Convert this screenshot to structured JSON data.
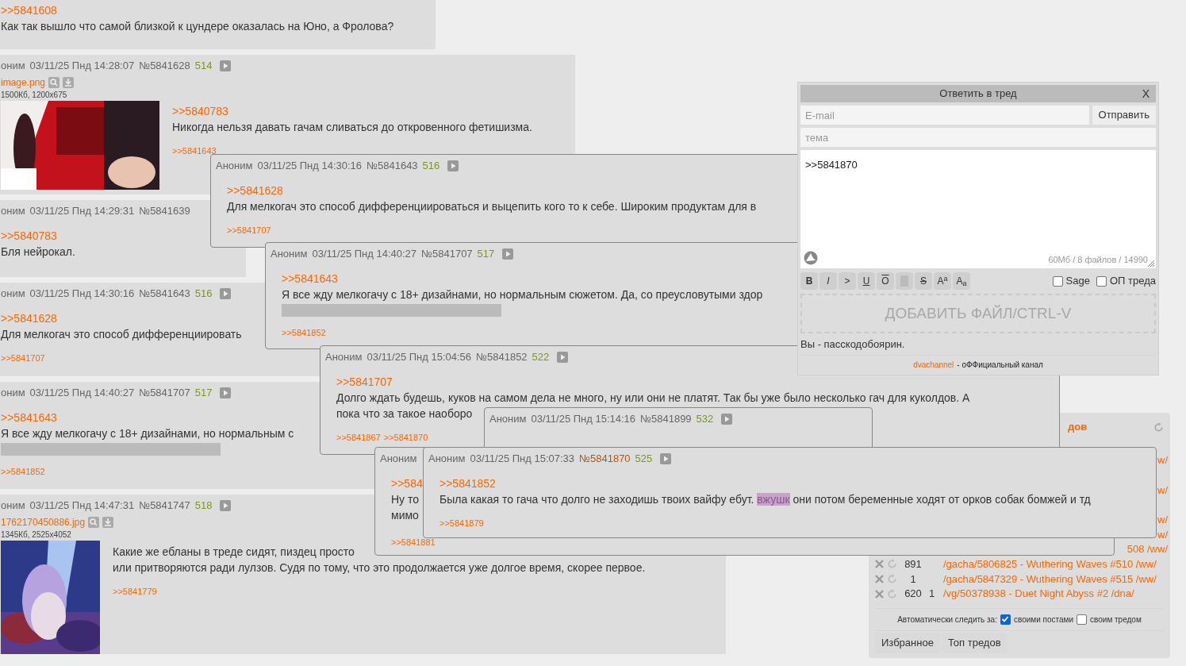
{
  "base_posts": [
    {
      "link": ">>5841608",
      "body": [
        "Как так вышло что самой близкой к цундере оказалась на Юно, а Фролова?"
      ]
    },
    {
      "header": {
        "name": "оним",
        "date": "03/11/25 Пнд 14:28:07",
        "number": "№5841628",
        "count": "514"
      },
      "file": {
        "name": "image.png",
        "info": "1500Кб, 1200x675",
        "kind": "picture"
      },
      "link": ">>5840783",
      "body": [
        "Никогда нельзя давать гачам сливаться до откровенного фетишизма."
      ],
      "replies": [
        ">>5841643"
      ]
    },
    {
      "header": {
        "name": "оним",
        "date": "03/11/25 Пнд 14:29:31",
        "number": "№5841639"
      },
      "link": ">>5840783",
      "body": [
        "Бля нейрокал."
      ]
    },
    {
      "header": {
        "name": "оним",
        "date": "03/11/25 Пнд 14:30:16",
        "number": "№5841643",
        "count": "516"
      },
      "link": ">>5841628",
      "body": [
        "Для мелкогач это способ дифференциировать"
      ],
      "replies": [
        ">>5841707"
      ]
    },
    {
      "header": {
        "name": "оним",
        "date": "03/11/25 Пнд 14:40:27",
        "number": "№5841707",
        "count": "517"
      },
      "link": ">>5841643",
      "body": [
        "Я все жду мелкогачу с 18+ дизайнами, но нормальным с"
      ],
      "spoiler_bar": true,
      "replies": [
        ">>5841852"
      ]
    },
    {
      "header": {
        "name": "оним",
        "date": "03/11/25 Пнд 14:47:31",
        "number": "№5841747",
        "count": "518"
      },
      "file": {
        "name": "1762170450886.jpg",
        "info": "1345Кб, 2525x4052",
        "kind": "picture"
      },
      "body": [
        "Какие же ебланы в треде сидят, пиздец просто",
        "или притворяются ради лулзов. Судя по тому, что это продолжается уже долгое время, скорее первое."
      ],
      "replies": [
        ">>5841779"
      ]
    }
  ],
  "popups": [
    {
      "header": {
        "name": "Аноним",
        "date": "03/11/25 Пнд 14:30:16",
        "number": "№5841643",
        "count": "516"
      },
      "link": ">>5841628",
      "body": [
        [
          {
            "text": "Для мелкогач это способ дифференциироваться и выцепить кого то к себе. Широким продуктам для в",
            "spoiler": false
          }
        ]
      ],
      "replies": [
        ">>5841707"
      ]
    },
    {
      "header": {
        "name": "Аноним",
        "date": "03/11/25 Пнд 14:40:27",
        "number": "№5841707",
        "count": "517"
      },
      "link": ">>5841643",
      "body": [
        [
          {
            "text": "Я все жду мелкогачу с 18+ дизайнами, но нормальным сюжетом. Да, со преусловутыми здор",
            "spoiler": false
          }
        ]
      ],
      "spoiler_bar": true,
      "replies": [
        ">>5841852"
      ]
    },
    {
      "header": {
        "name": "Аноним",
        "date": "03/11/25 Пнд 15:04:56",
        "number": "№5841852",
        "count": "522"
      },
      "link": ">>5841707",
      "body": [
        [
          {
            "text": "Долго ждать будешь, куков на самом дела не много, ну или они не платят. Так бы уже было несколько гач для куколдов. А",
            "spoiler": false
          }
        ],
        [
          {
            "text": "пока что за такое наоборо",
            "spoiler": false
          }
        ]
      ],
      "replies": [
        ">>5841867",
        ">>5841870"
      ]
    },
    {
      "header": {
        "name": "Аноним",
        "date": "03/11/25 Пнд 15:14:16",
        "number": "№5841899",
        "count": "532"
      }
    },
    {
      "header": {
        "name": "Аноним"
      },
      "link": ">>584",
      "body": [
        [
          {
            "text": "Ну то",
            "spoiler": false
          }
        ],
        [
          {
            "text": "мимо",
            "spoiler": false
          }
        ]
      ],
      "replies": [
        ">>5841881"
      ]
    },
    {
      "header": {
        "name": "Аноним",
        "date": "03/11/25 Пнд 15:07:33",
        "number": "№5841870",
        "count": "525",
        "own": true
      },
      "link": ">>5841852",
      "body": [
        [
          {
            "text": "Была какая то гача что долго не заходишь твоих вайфу ебут. ",
            "spoiler": false
          },
          {
            "text": "вжушк",
            "spoiler": true
          },
          {
            "text": " они потом беременные ходят от орков собак бомжей и тд",
            "spoiler": false
          }
        ]
      ],
      "replies": [
        ">>5841879"
      ]
    }
  ],
  "reply_form": {
    "title": "Ответить в тред",
    "close": "X",
    "email": {
      "placeholder": "E-mail"
    },
    "send": "Отправить",
    "subject": {
      "placeholder": "тема"
    },
    "message": ">>5841870",
    "limits": "60Мб / 8 файлов / 14990",
    "toolbar": [
      {
        "kind": "text",
        "label": "B"
      },
      {
        "kind": "text",
        "label": "I"
      },
      {
        "kind": "text",
        "label": ">"
      },
      {
        "kind": "text",
        "label": "U"
      },
      {
        "kind": "text",
        "label": "O"
      },
      {
        "kind": "spoiler"
      },
      {
        "kind": "text",
        "label": "S"
      },
      {
        "kind": "text",
        "label": "A$^{a}$"
      },
      {
        "kind": "text",
        "label": "A$_{a}$"
      }
    ],
    "options": [
      {
        "label": "Sage",
        "checked": false
      },
      {
        "label": "ОП треда",
        "checked": false
      }
    ],
    "dropzone": "ДОБАВИТЬ ФАЙЛ/CTRL-V",
    "status": "Вы - пасскодобоярин.",
    "footer_link": "dvachannel",
    "footer_text": "- оФФициальный канал"
  },
  "favorites": {
    "title": "дов",
    "rows": [
      {
        "kind": "blank"
      },
      {
        "kind": "fragment",
        "text": "w/"
      },
      {
        "kind": "blank"
      },
      {
        "kind": "fragment",
        "text": "w/"
      },
      {
        "kind": "blank"
      },
      {
        "kind": "fragment",
        "text": "w/"
      },
      {
        "kind": "fragment",
        "text": "w/"
      },
      {
        "kind": "fragment",
        "text": "508 /ww/"
      },
      {
        "kind": "thread",
        "count": "891",
        "title": "/gacha/5806825 - Wuthering Waves #510 /ww/"
      },
      {
        "kind": "thread",
        "count": "1",
        "title": "/gacha/5847329 - Wuthering Waves #515 /ww/"
      },
      {
        "kind": "thread",
        "count": "620",
        "unread": "1",
        "title": "/vg/50378938 - Duet Night Abyss #2 /dna/"
      }
    ],
    "auto_follow": {
      "label": "Автоматически следить за:",
      "options": [
        {
          "label": "своими постами",
          "checked": true
        },
        {
          "label": "своим тредом",
          "checked": false
        }
      ]
    },
    "tabs": [
      "Избранное",
      "Топ тредов"
    ]
  }
}
